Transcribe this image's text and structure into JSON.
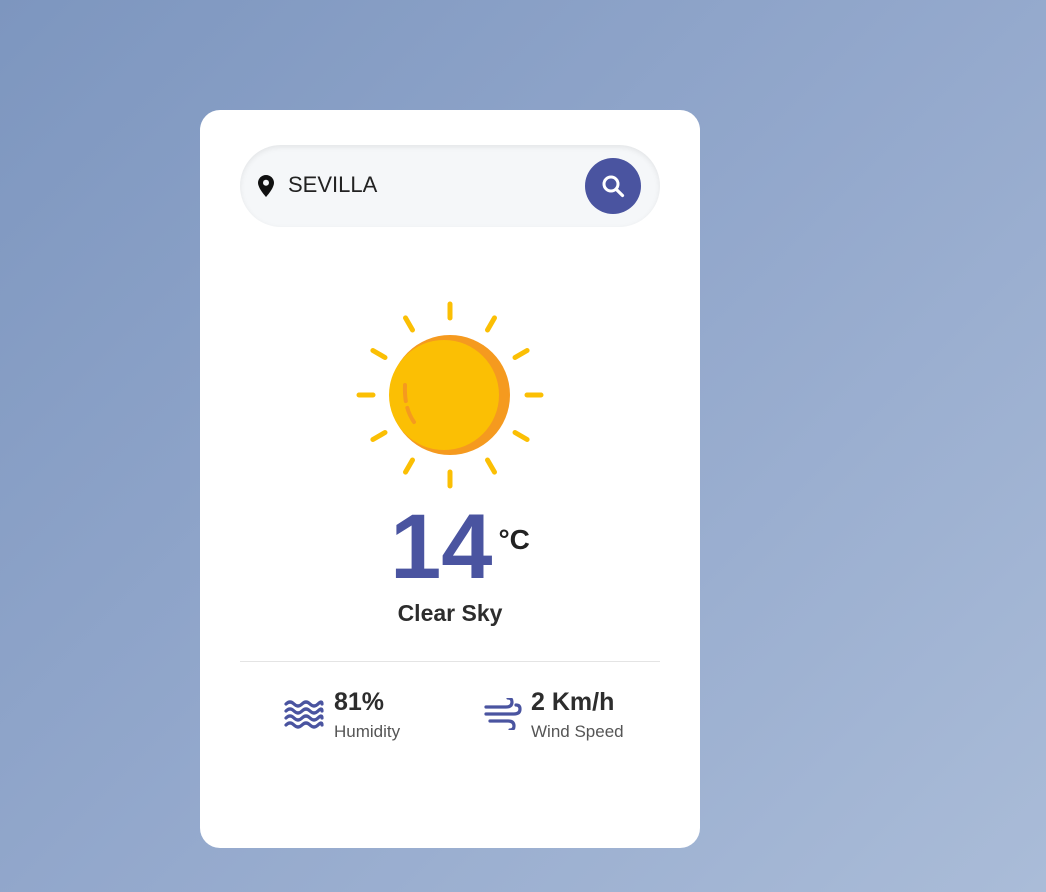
{
  "colors": {
    "accent": "#4a54a0",
    "sun": "#fbbf04",
    "sun_shade": "#f59a1f",
    "card": "#ffffff",
    "text": "#2d2d2d"
  },
  "search": {
    "value": "SEVILLA",
    "location_icon": "map-pin-icon",
    "button_icon": "search-icon"
  },
  "weather": {
    "icon": "sun-icon",
    "temperature": "14",
    "unit": "°C",
    "description": "Clear Sky"
  },
  "details": {
    "humidity": {
      "icon": "waves-icon",
      "value": "81%",
      "label": "Humidity"
    },
    "wind": {
      "icon": "wind-icon",
      "value": "2 Km/h",
      "label": "Wind Speed"
    }
  }
}
